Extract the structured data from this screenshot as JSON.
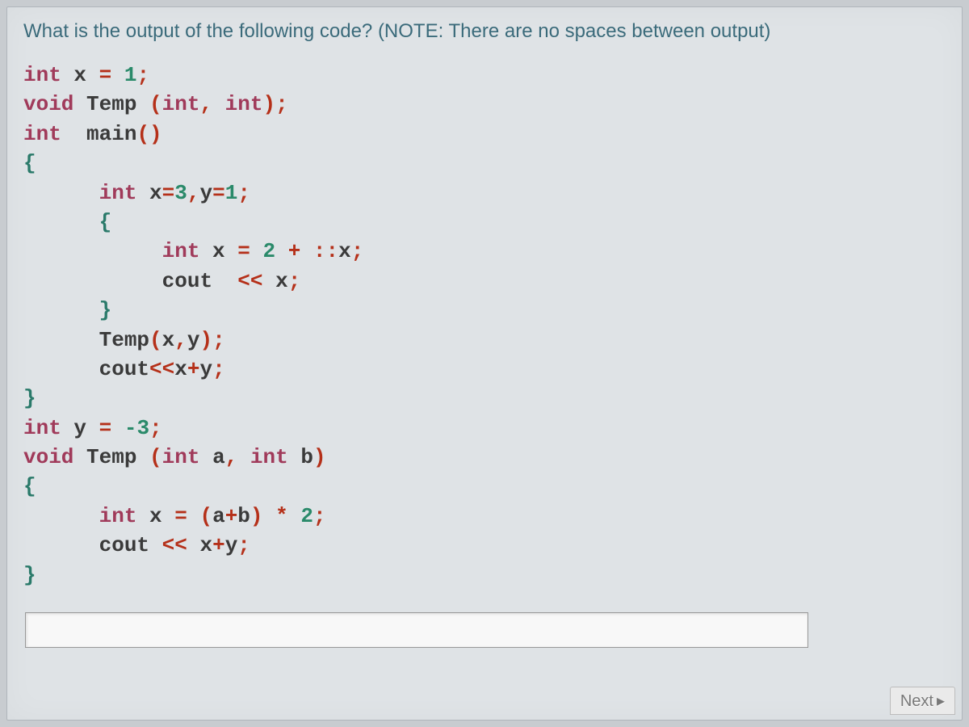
{
  "question": "What is the output of the following code? (NOTE: There are no spaces between output)",
  "code": {
    "l1": {
      "kw": "int",
      "id": " x ",
      "op1": "=",
      "num": " 1",
      "op2": ";"
    },
    "l2": {
      "kw1": "void",
      "id1": " Temp ",
      "op1": "(",
      "kw2": "int",
      "op2": ",",
      "kw3": " int",
      "op3": ");"
    },
    "l3": {
      "kw": "int",
      "id": "  main",
      "op": "()"
    },
    "l4": {
      "brace": "{"
    },
    "l5": {
      "kw": "int",
      "id1": " x",
      "op1": "=",
      "num1": "3",
      "op2": ",",
      "id2": "y",
      "op3": "=",
      "num2": "1",
      "op4": ";"
    },
    "l6": {
      "brace": "{"
    },
    "l7": {
      "kw": "int",
      "id": " x ",
      "op1": "=",
      "num": " 2 ",
      "op2": "+ ::",
      "id2": "x",
      "op3": ";"
    },
    "l8": {
      "id1": "cout  ",
      "op1": "<<",
      "id2": " x",
      "op2": ";"
    },
    "l9": {
      "brace": "}"
    },
    "l10": {
      "id": "Temp",
      "op1": "(",
      "id2": "x",
      "op2": ",",
      "id3": "y",
      "op3": ");"
    },
    "l11": {
      "id1": "cout",
      "op1": "<<",
      "id2": "x",
      "op2": "+",
      "id3": "y",
      "op3": ";"
    },
    "l12": {
      "brace": "}"
    },
    "l13": {
      "kw": "int",
      "id": " y ",
      "op1": "=",
      "num": " -3",
      "op2": ";"
    },
    "l14": {
      "kw1": "void",
      "id1": " Temp ",
      "op1": "(",
      "kw2": "int",
      "id2": " a",
      "op2": ",",
      "kw3": " int",
      "id3": " b",
      "op3": ")"
    },
    "l15": {
      "brace": "{"
    },
    "l16": {
      "kw": "int",
      "id": " x ",
      "op1": "=",
      "op2": " (",
      "id2": "a",
      "op3": "+",
      "id3": "b",
      "op4": ") * ",
      "num": "2",
      "op5": ";"
    },
    "l17": {
      "id1": "cout ",
      "op1": "<<",
      "id2": " x",
      "op2": "+",
      "id3": "y",
      "op3": ";"
    },
    "l18": {
      "brace": "}"
    }
  },
  "answer_value": "",
  "next_label": "Next"
}
